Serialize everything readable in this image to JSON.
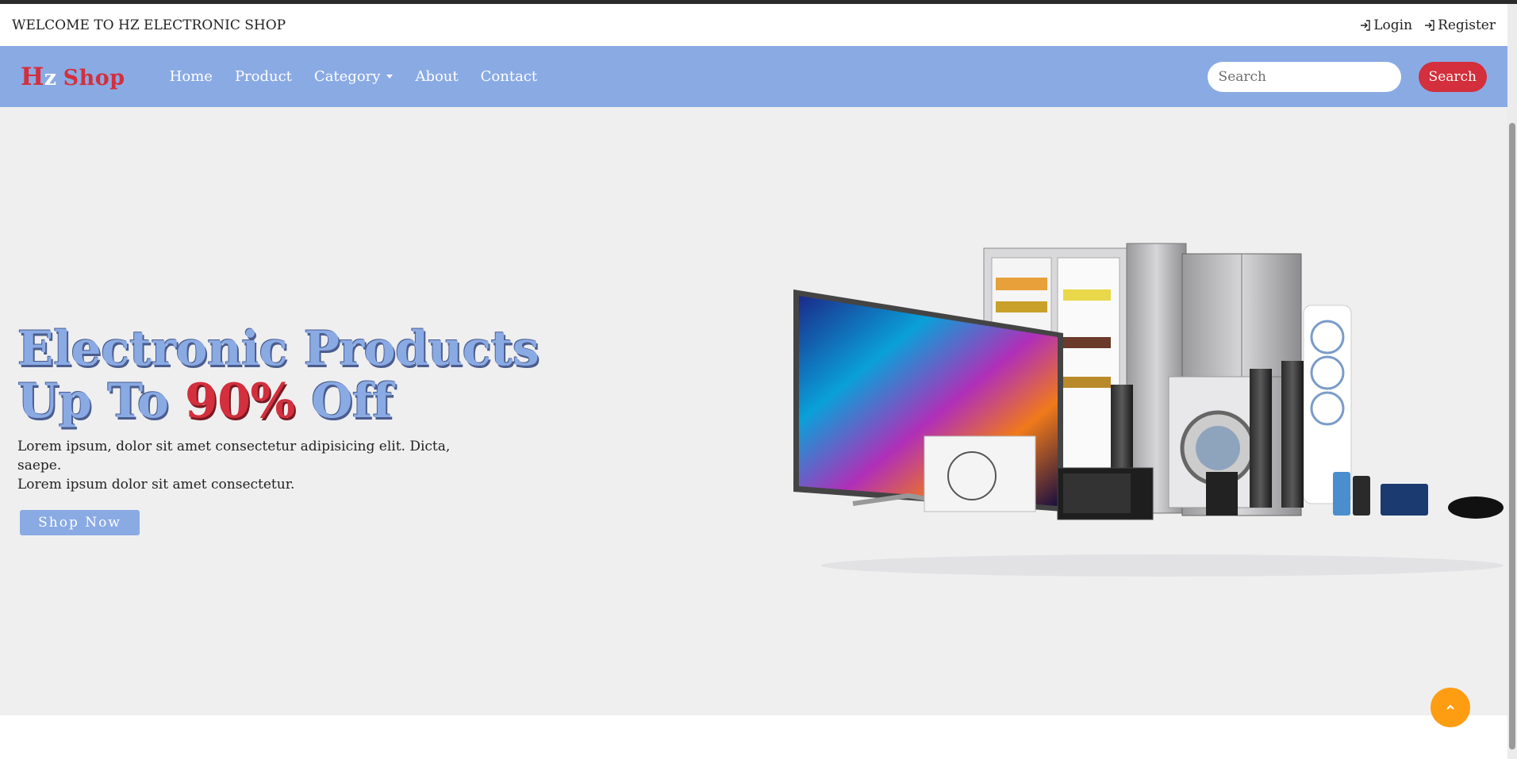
{
  "topbar": {
    "welcome": "WELCOME TO HZ ELECTRONIC SHOP",
    "login_label": "Login",
    "register_label": "Register",
    "login_icon": "sign-in-icon",
    "register_icon": "sign-in-icon"
  },
  "navbar": {
    "logo_h": "H",
    "logo_z": "z",
    "logo_shop": "Shop",
    "items": [
      {
        "label": "Home"
      },
      {
        "label": "Product"
      },
      {
        "label": "Category"
      },
      {
        "label": "About"
      },
      {
        "label": "Contact"
      }
    ],
    "search_placeholder": "Search",
    "search_value": "",
    "search_button": "Search"
  },
  "hero": {
    "line1": "Electronic Products",
    "line2_prefix": "Up To ",
    "line2_pct": "90%",
    "line2_suffix": " Off",
    "desc_line1": "Lorem ipsum, dolor sit amet consectetur adipisicing elit. Dicta, saepe.",
    "desc_line2": "Lorem ipsum dolor sit amet consectetur.",
    "cta": "Shop Now"
  },
  "colors": {
    "nav_bg": "#8aaae4",
    "brand_red": "#d32f3c",
    "hero_bg": "#efeff0",
    "scroll_top_bg": "#ff9d12"
  },
  "icons": {
    "scroll_top": "chevron-up-icon",
    "dropdown": "caret-down-icon"
  }
}
